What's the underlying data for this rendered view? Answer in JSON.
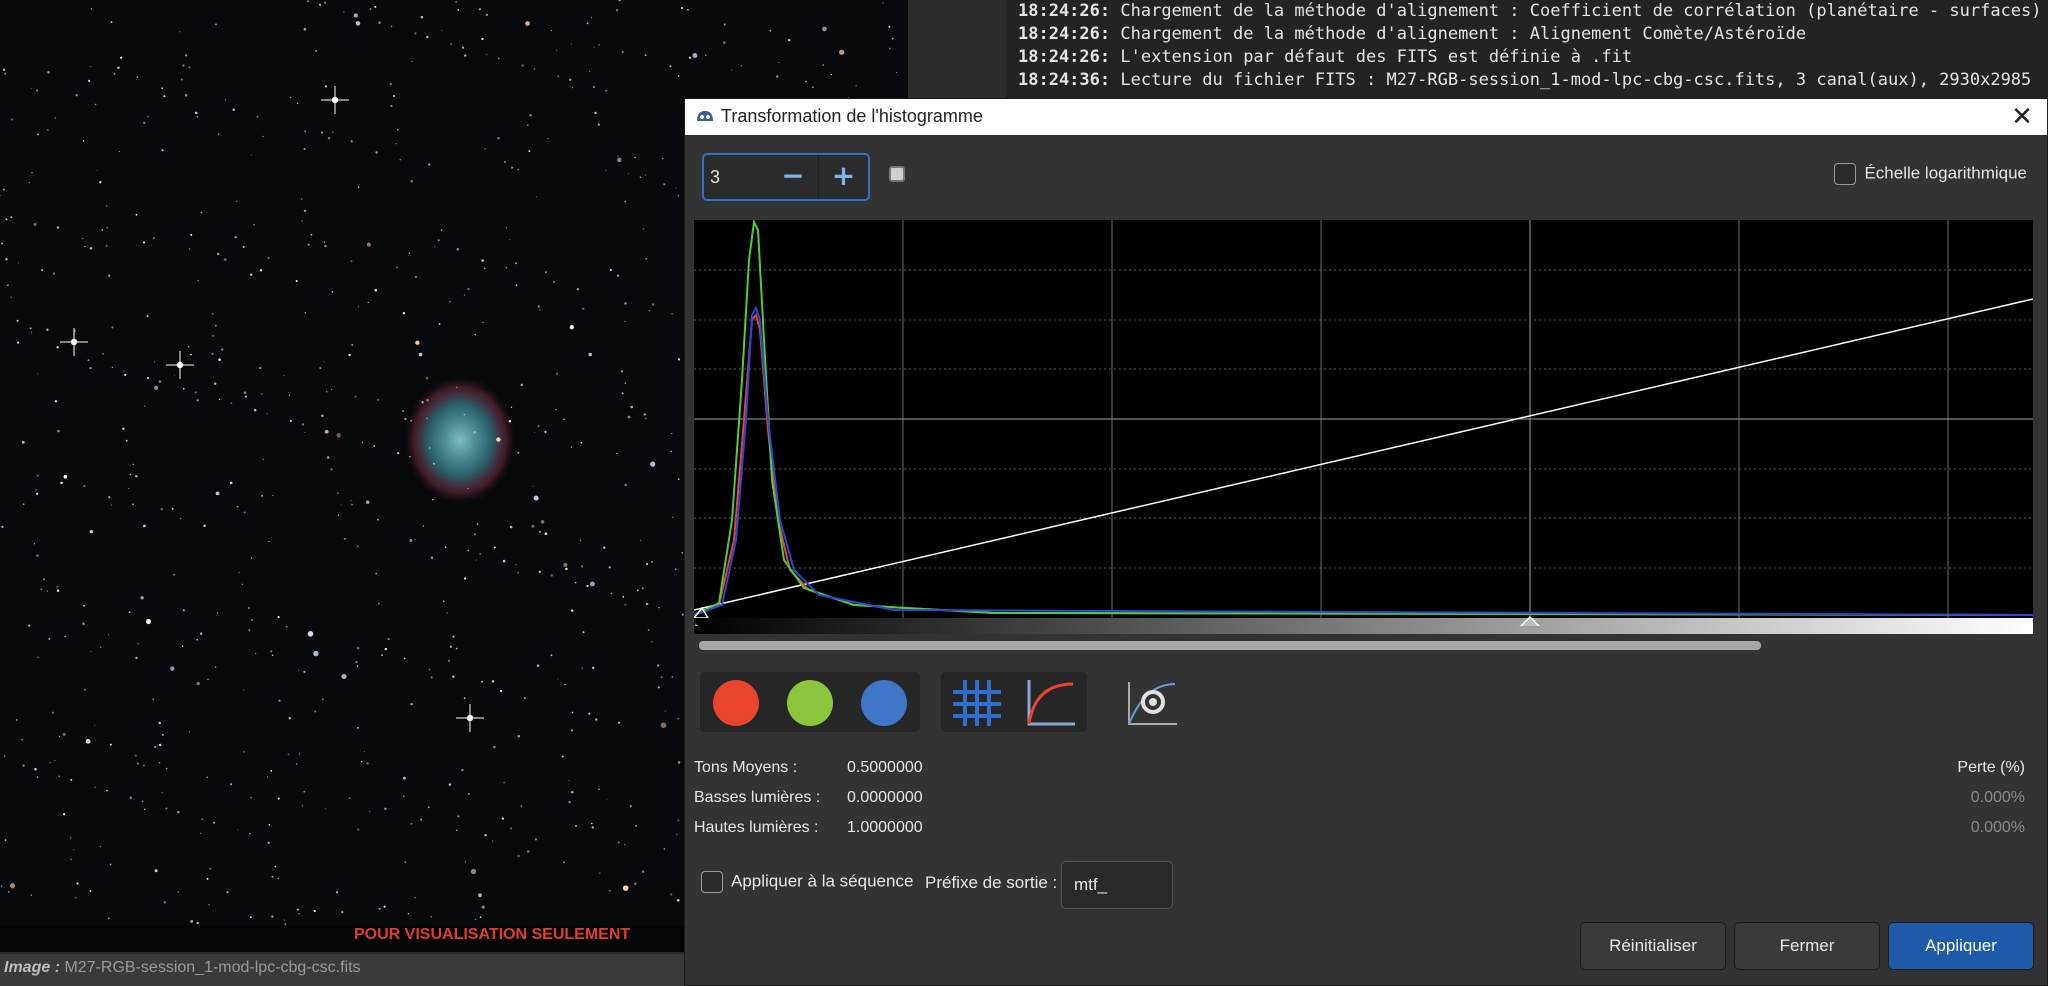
{
  "image": {
    "watermark": "POUR VISUALISATION SEULEMENT",
    "status_label": "Image :",
    "status_value": "M27-RGB-session_1-mod-lpc-cbg-csc.fits"
  },
  "log": [
    {
      "time": "18:24:26:",
      "text": "Chargement de la méthode d'alignement : Coefficient de corrélation (planétaire - surfaces)"
    },
    {
      "time": "18:24:26:",
      "text": "Chargement de la méthode d'alignement : Alignement Comète/Astéroïde"
    },
    {
      "time": "18:24:26:",
      "text": "L'extension par défaut des FITS est définie à .fit"
    },
    {
      "time": "18:24:36:",
      "text": "Lecture du fichier FITS : M27-RGB-session_1-mod-lpc-cbg-csc.fits, 3 canal(aux), 2930x2985"
    }
  ],
  "dialog": {
    "title": "Transformation de l'histogramme",
    "zoom_value": "3",
    "zoom_minus": "−",
    "zoom_plus": "+",
    "log_scale_label": "Échelle logarithmique",
    "midtones_label": "Tons Moyens :",
    "midtones_value": "0.5000000",
    "shadows_label": "Basses lumières :",
    "shadows_value": "0.0000000",
    "highlights_label": "Hautes lumières :",
    "highlights_value": "1.0000000",
    "loss_label": "Perte (%)",
    "shadows_loss": "0.000%",
    "highlights_loss": "0.000%",
    "apply_sequence_label": "Appliquer à la séquence",
    "prefix_label": "Préfixe de sortie :",
    "prefix_value": "mtf_",
    "reset_button": "Réinitialiser",
    "close_button": "Fermer",
    "apply_button": "Appliquer"
  },
  "colors": {
    "red_channel": "#e8452c",
    "green_channel": "#8cc63f",
    "blue_channel": "#3f76c8",
    "accent": "#1d5aa8"
  },
  "icons": [
    "close-icon",
    "grid-icon",
    "curve-icon",
    "auto-stretch-icon",
    "reset-zoom-icon",
    "app-icon"
  ]
}
